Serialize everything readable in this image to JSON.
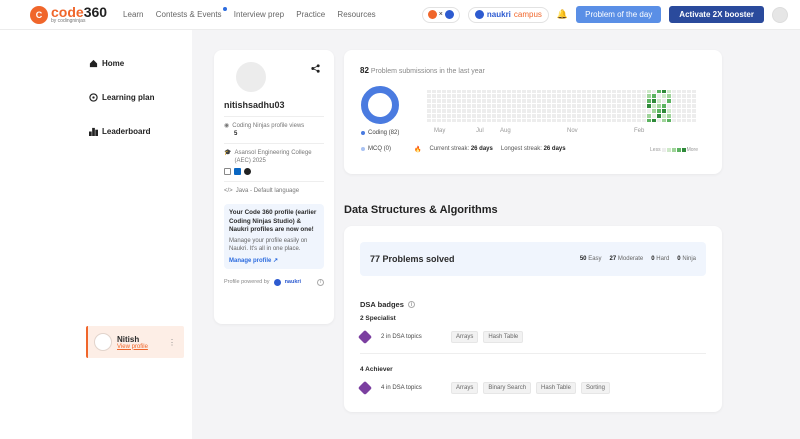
{
  "header": {
    "logo_text_a": "code",
    "logo_text_b": "360",
    "logo_sub": "by codingninjas",
    "nav": [
      "Learn",
      "Contests & Events",
      "Interview prep",
      "Practice",
      "Resources"
    ],
    "partner_x": "×",
    "naukri_brand": "naukri",
    "naukri_campus": "campus",
    "potd_label": "Problem of the day",
    "boost_label": "Activate 2X booster"
  },
  "sidebar": {
    "items": [
      {
        "label": "Home",
        "icon": "home-icon"
      },
      {
        "label": "Learning plan",
        "icon": "compass-icon"
      },
      {
        "label": "Leaderboard",
        "icon": "leaderboard-icon"
      }
    ],
    "user_name": "Nitish",
    "user_link": "View profile"
  },
  "profile": {
    "username": "nitishsadhu03",
    "views_label": "Coding Ninjas profile views",
    "views_value": "5",
    "college": "Asansol Engineering College (AEC) 2025",
    "language": "Java - Default language",
    "notice_title": "Your Code 360 profile (earlier Coding Ninjas Studio) & Naukri profiles are now one!",
    "notice_desc": "Manage your profile easily on Naukri. It's all in one place.",
    "notice_link": "Manage profile",
    "powered_label": "Profile powered by",
    "powered_brand": "naukri"
  },
  "submissions": {
    "count": "82",
    "label": "Problem submissions in the last year",
    "legend": [
      {
        "label": "Coding (82)",
        "color": "#4a7be0"
      },
      {
        "label": "MCQ (0)",
        "color": "#a9c2f2"
      }
    ],
    "months": [
      "May",
      "Jul",
      "Aug",
      "Nov",
      "Feb"
    ],
    "current_label": "Current streak:",
    "current_value": "26 days",
    "longest_label": "Longest streak:",
    "longest_value": "26 days",
    "less": "Less",
    "more": "More"
  },
  "dsa": {
    "heading": "Data Structures & Algorithms",
    "solved": "77 Problems solved",
    "difficulty": [
      {
        "count": "50",
        "label": "Easy"
      },
      {
        "count": "27",
        "label": "Moderate"
      },
      {
        "count": "0",
        "label": "Hard"
      },
      {
        "count": "0",
        "label": "Ninja"
      }
    ],
    "badges_title": "DSA badges",
    "levels": [
      {
        "name": "2 Specialist",
        "topics": "2 in DSA topics",
        "chips": [
          "Arrays",
          "Hash Table"
        ]
      },
      {
        "name": "4 Achiever",
        "topics": "4 in DSA topics",
        "chips": [
          "Arrays",
          "Binary Search",
          "Hash Table",
          "Sorting"
        ]
      }
    ]
  }
}
